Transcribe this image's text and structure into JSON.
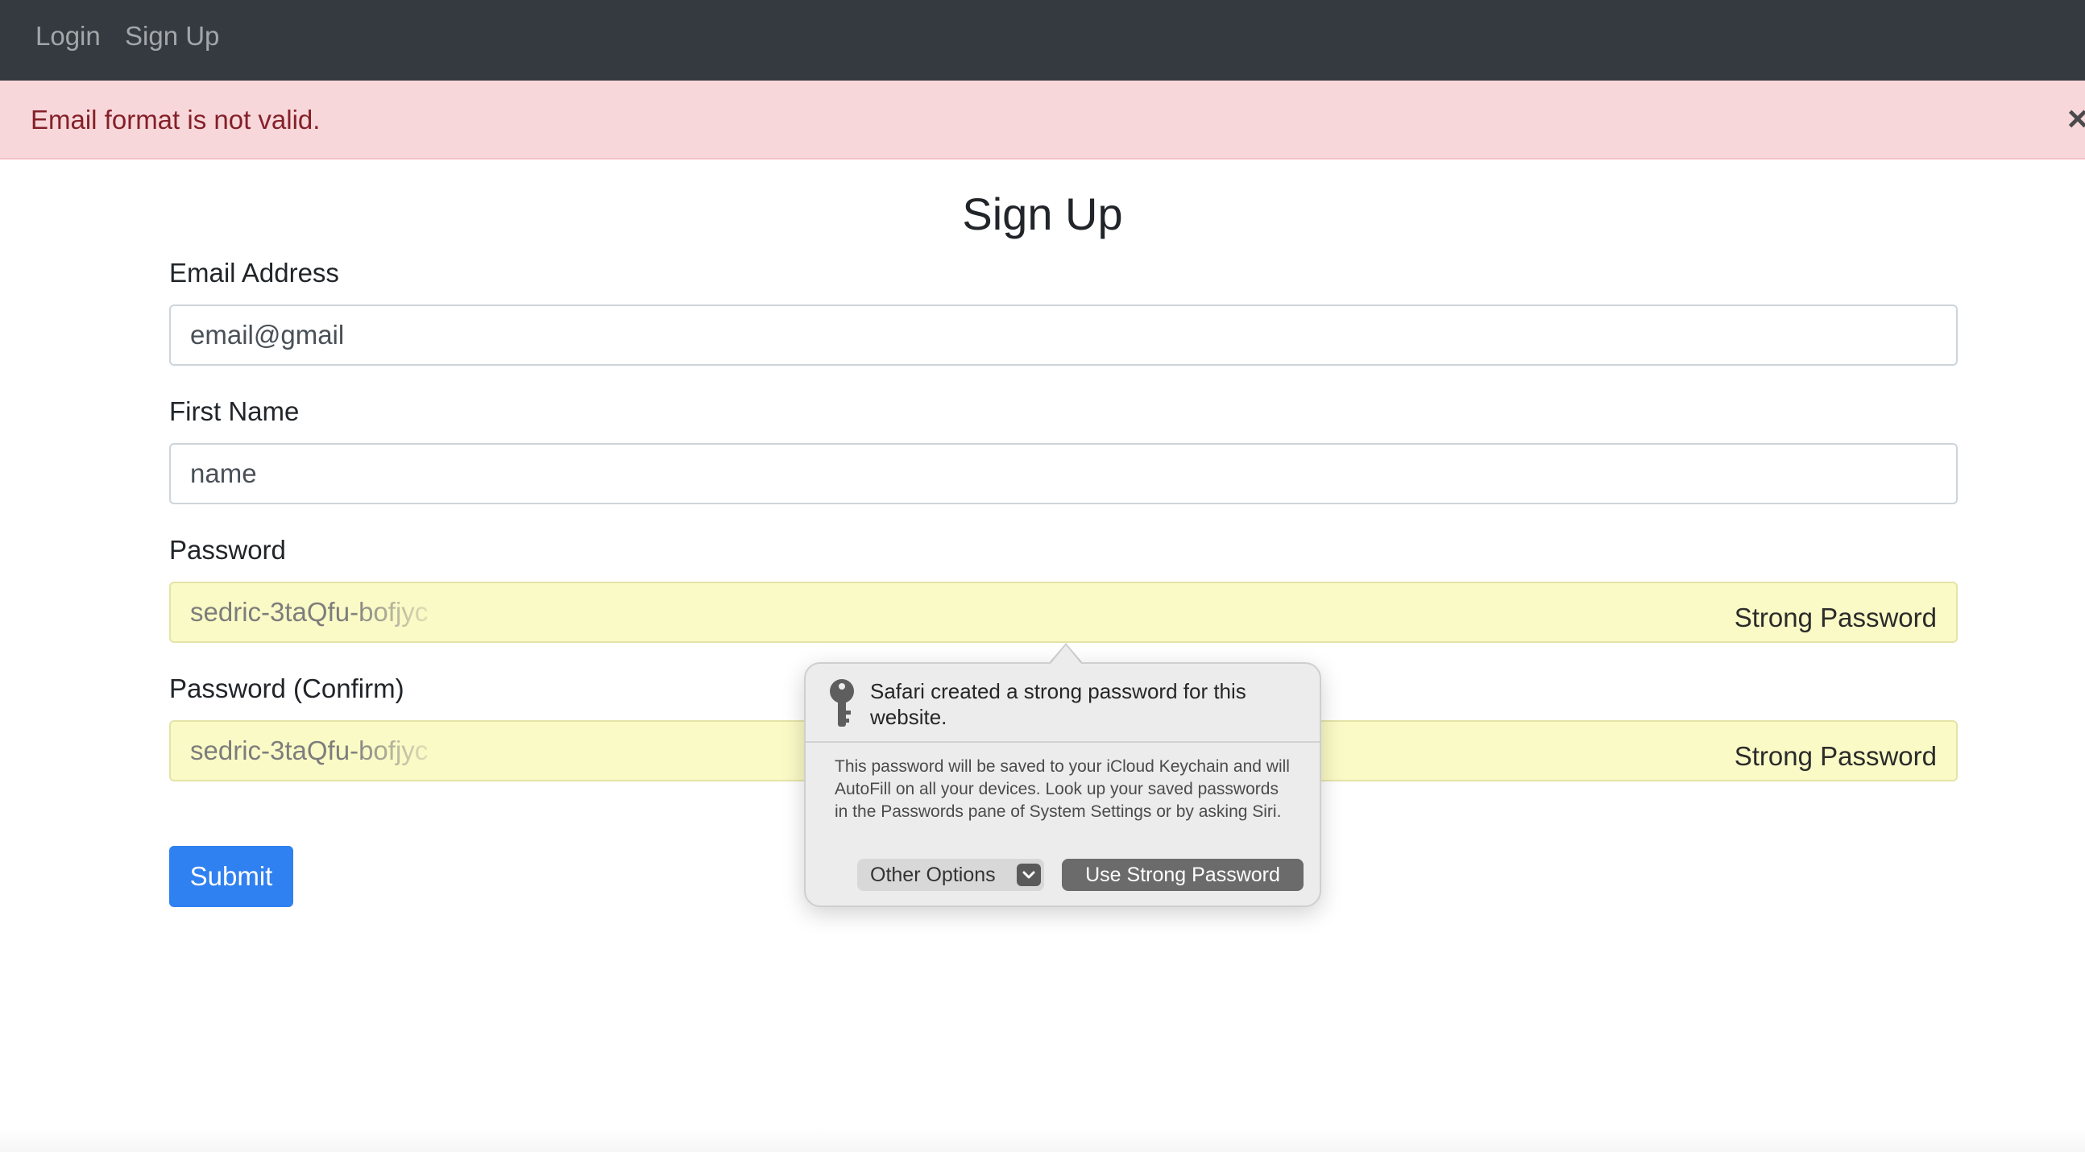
{
  "navbar": {
    "links": [
      {
        "label": "Login"
      },
      {
        "label": "Sign Up"
      }
    ]
  },
  "alert": {
    "message": "Email format is not valid.",
    "close_icon": "close-icon"
  },
  "form": {
    "title": "Sign Up",
    "email": {
      "label": "Email Address",
      "value": "email@gmail"
    },
    "first_name": {
      "label": "First Name",
      "value": "name"
    },
    "password": {
      "label": "Password",
      "value": "sedric-3taQfu-bofjyc",
      "badge": "Strong Password"
    },
    "password_confirm": {
      "label": "Password (Confirm)",
      "value": "sedric-3taQfu-bofjyc",
      "badge": "Strong Password"
    },
    "submit_label": "Submit"
  },
  "safari_popover": {
    "icon": "key-icon",
    "title": "Safari created a strong password for this website.",
    "body": "This password will be saved to your iCloud Keychain and will AutoFill on all your devices. Look up your saved passwords in the Passwords pane of System Settings or by asking Siri.",
    "other_options_label": "Other Options",
    "use_label": "Use Strong Password"
  },
  "colors": {
    "navbar_bg": "#343a40",
    "alert_bg": "#f8d7da",
    "alert_text": "#842029",
    "autofill_bg": "#fafac6",
    "primary": "#2f80f0"
  }
}
